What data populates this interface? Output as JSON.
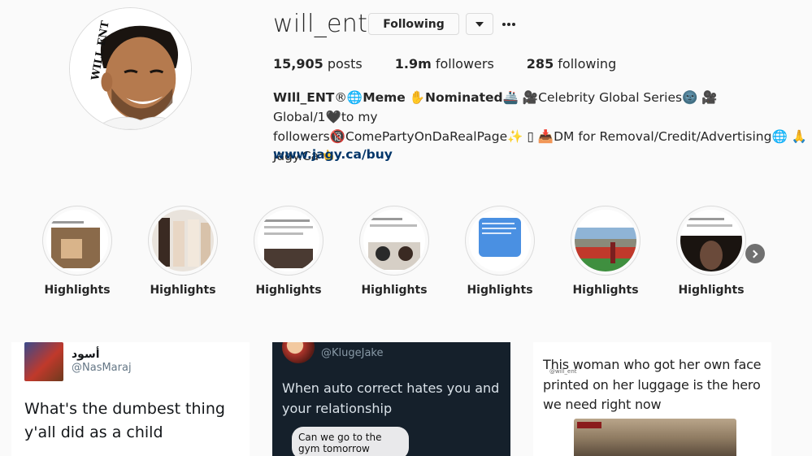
{
  "profile": {
    "username": "will_ent",
    "follow_label": "Following",
    "avatar_text": "WILL ENT"
  },
  "stats": {
    "posts_count": "15,905",
    "posts_label": "posts",
    "followers_count": "1.9m",
    "followers_label": "followers",
    "following_count": "285",
    "following_label": "following"
  },
  "bio": {
    "name": "WIll_ENT",
    "sym1": "®🌐",
    "meme": "Meme",
    "sym2": " ✋",
    "nominated": "Nominated",
    "line1_rest": "🚢 🎥Celebrity Global Series🌚 🎥Global/1🖤to my",
    "line2": "followers🔞ComePartyOnDaRealPage✨ ▯ 📥DM for Removal/Credit/Advertising🌐 🙏",
    "line3": "Jagy.Ca👈",
    "link": "www.jagy.ca/buy"
  },
  "highlights": [
    {
      "label": "Highlights",
      "icon": "highlight-cover-1"
    },
    {
      "label": "Highlights",
      "icon": "highlight-cover-2"
    },
    {
      "label": "Highlights",
      "icon": "highlight-cover-3"
    },
    {
      "label": "Highlights",
      "icon": "highlight-cover-4"
    },
    {
      "label": "Highlights",
      "icon": "highlight-cover-5"
    },
    {
      "label": "Highlights",
      "icon": "highlight-cover-6"
    },
    {
      "label": "Highlights",
      "icon": "highlight-cover-7"
    }
  ],
  "posts": [
    {
      "name": "أسود",
      "handle": "@NasMaraj",
      "text": "What's the dumbest thing y'all did as a child"
    },
    {
      "handle": "@KlugeJake",
      "text": "When auto correct hates you and your relationship",
      "bubble": "Can we go to the gym tomorrow"
    },
    {
      "text": "This woman who got her own face printed on her luggage is the hero we need right now",
      "watermark": "@will_ent"
    }
  ]
}
